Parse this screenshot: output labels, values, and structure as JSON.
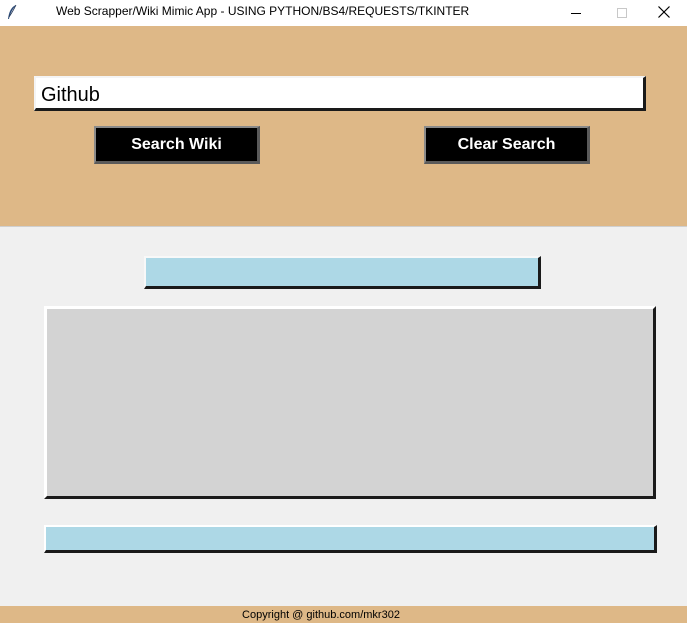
{
  "window": {
    "title": "Web Scrapper/Wiki Mimic App - USING PYTHON/BS4/REQUESTS/TKINTER",
    "icon": "feather-icon",
    "controls": [
      "minimize-icon",
      "maximize-icon",
      "close-icon"
    ]
  },
  "search": {
    "value": "Github"
  },
  "buttons": {
    "search_label": "Search Wiki",
    "clear_label": "Clear Search"
  },
  "results": {
    "title": "",
    "content": "",
    "link": ""
  },
  "footer": {
    "text": "Copyright @ github.com/mkr302"
  },
  "colors": {
    "panel": "#deb887",
    "label_bg": "#add8e6",
    "content_bg": "#d3d3d3",
    "button_bg": "#000000",
    "body_bg": "#f0f0f0"
  }
}
